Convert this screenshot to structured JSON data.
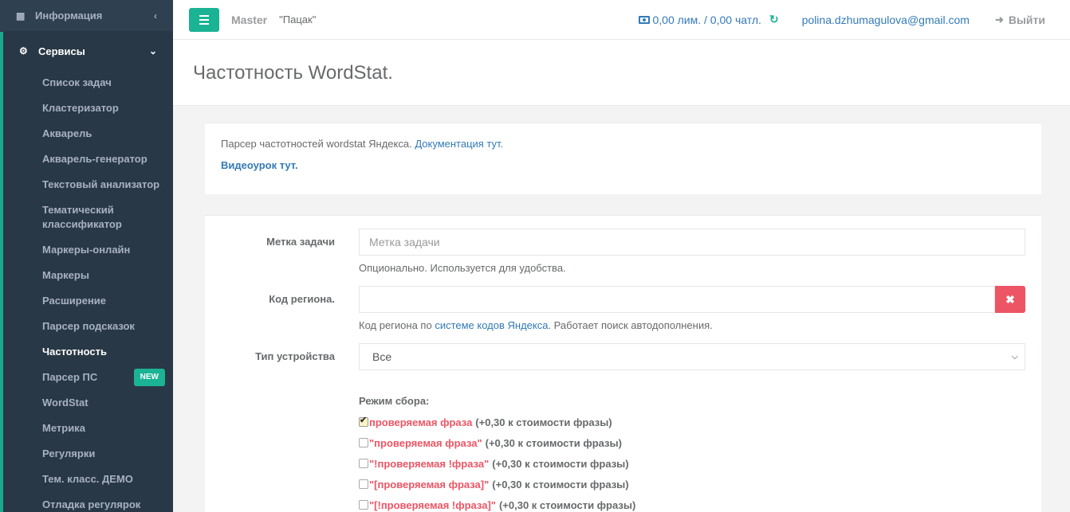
{
  "sidebar": {
    "top_item": {
      "label": "Информация",
      "icon": "briefcase-icon"
    },
    "section": {
      "label": "Сервисы",
      "icon": "cogs-icon"
    },
    "items": [
      {
        "label": "Список задач"
      },
      {
        "label": "Кластеризатор"
      },
      {
        "label": "Акварель"
      },
      {
        "label": "Акварель-генератор"
      },
      {
        "label": "Текстовый анализатор"
      },
      {
        "label": "Тематический классификатор"
      },
      {
        "label": "Маркеры-онлайн"
      },
      {
        "label": "Маркеры"
      },
      {
        "label": "Расширение"
      },
      {
        "label": "Парсер подсказок"
      },
      {
        "label": "Частотность"
      },
      {
        "label": "Парсер ПС",
        "badge": "NEW"
      },
      {
        "label": "WordStat"
      },
      {
        "label": "Метрика"
      },
      {
        "label": "Регулярки"
      },
      {
        "label": "Тем. класс. ДЕМО"
      },
      {
        "label": "Отладка регулярок"
      }
    ],
    "active_item": "Частотность"
  },
  "topbar": {
    "master": "Master",
    "project": "\"Пацак\"",
    "balance": "0,00 лим. / 0,00 чатл.",
    "email": "polina.dzhumagulova@gmail.com",
    "logout": "Выйти"
  },
  "page": {
    "title": "Частотность WordStat."
  },
  "info": {
    "text": "Парсер частотностей wordstat Яндекса. ",
    "doc_link": "Документация тут.",
    "video_link": "Видеоурок тут."
  },
  "form": {
    "task_label": {
      "label": "Метка задачи",
      "placeholder": "Метка задачи",
      "help": "Опционально. Используется для удобства."
    },
    "region": {
      "label": "Код региона.",
      "help_before": "Код региона по ",
      "help_link": "системе кодов Яндекса",
      "help_after": ". Работает поиск автодополнения.",
      "value": ""
    },
    "device": {
      "label": "Тип устройства",
      "selected": "Все"
    },
    "mode": {
      "title": "Режим сбора:",
      "options": [
        {
          "phrase": "проверяемая фраза",
          "cost": "(+0,30 к стоимости фразы)",
          "checked": true
        },
        {
          "phrase": "\"проверяемая фраза\"",
          "cost": "(+0,30 к стоимости фразы)",
          "checked": false
        },
        {
          "phrase": "\"!проверяемая !фраза\"",
          "cost": "(+0,30 к стоимости фразы)",
          "checked": false
        },
        {
          "phrase": "\"[проверяемая фраза]\"",
          "cost": "(+0,30 к стоимости фразы)",
          "checked": false
        },
        {
          "phrase": "\"[!проверяемая !фраза]\"",
          "cost": "(+0,30 к стоимости фразы)",
          "checked": false
        }
      ]
    }
  },
  "colors": {
    "sidebar_bg": "#2f4050",
    "accent": "#1ab394",
    "link": "#337ab7",
    "danger": "#ed5565"
  }
}
